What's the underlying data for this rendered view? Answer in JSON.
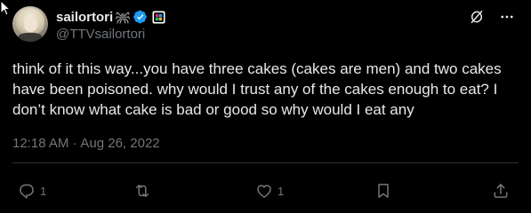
{
  "user": {
    "display_name": "sailortori",
    "name_emoji": "🕷",
    "handle": "@TTVsailortori"
  },
  "tweet": {
    "text": "think of it this way...you have three cakes (cakes are men) and two cakes have been poisoned. why would I trust any of the cakes enough to eat? I don’t know what cake is bad or good so why would I eat any",
    "time": "12:18 AM",
    "separator": "·",
    "date": "Aug 26, 2022"
  },
  "actions": {
    "reply_count": "1",
    "retweet_count": "",
    "like_count": "1"
  },
  "colors": {
    "background": "#000000",
    "text": "#e7e9ea",
    "secondary_text": "#71767b",
    "verified": "#1d9bf0",
    "divider": "#2f3336"
  },
  "icons": {
    "top": [
      "grok-icon",
      "more-icon"
    ],
    "actions": [
      "reply-icon",
      "retweet-icon",
      "like-icon",
      "bookmark-icon",
      "share-icon"
    ]
  }
}
